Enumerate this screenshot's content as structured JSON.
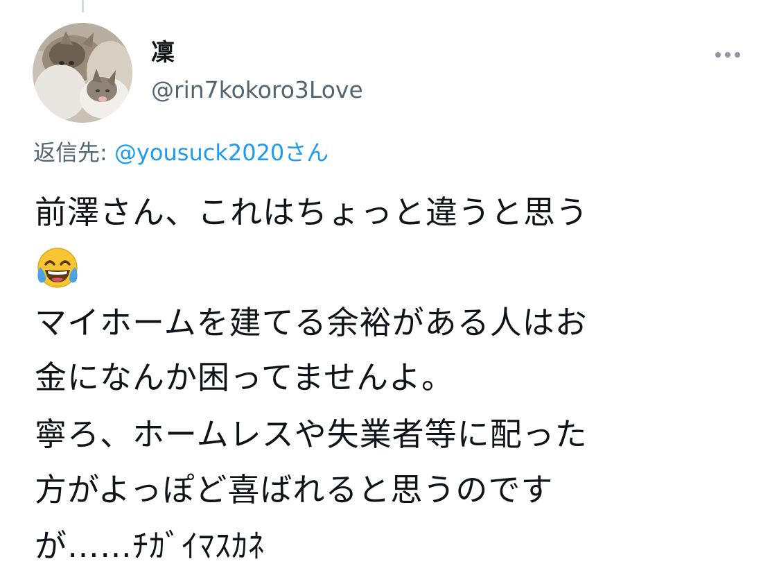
{
  "tweet": {
    "author": {
      "display_name": "凜",
      "handle": "@rin7kokoro3Love",
      "avatar_icon": "cat-avatar"
    },
    "more_icon": "more-dots-icon",
    "reply": {
      "prefix": "返信先:",
      "mention": "@yousuck2020さん"
    },
    "lines": [
      "前澤さん、これはちょっと違うと思う",
      "マイホームを建てる余裕がある人はお",
      "金になんか困ってませんよ。",
      "寧ろ、ホームレスや失業者等に配った",
      "方がよっぽど喜ばれると思うのです",
      "が……ﾁｶﾞｲﾏｽｶﾈ"
    ],
    "emoji": "face-with-tears-of-joy-icon"
  }
}
